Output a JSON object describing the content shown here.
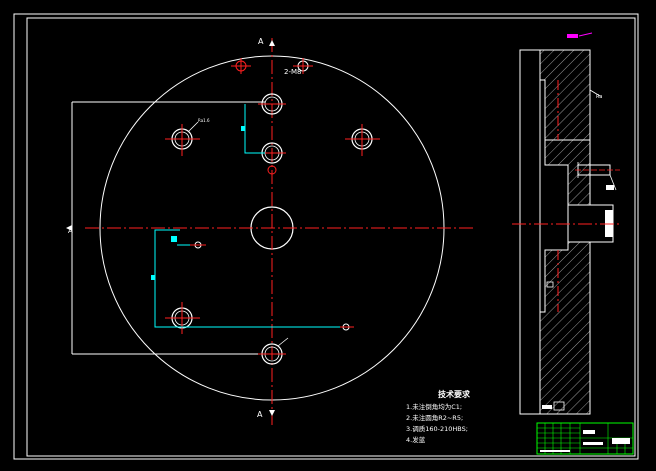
{
  "drawing": {
    "section_marks": {
      "top": "A",
      "bottom": "A",
      "left": "A"
    },
    "hole_label": "2-M8",
    "dimension_note": "Ra1.6",
    "side_view_note": "Ra",
    "notes": {
      "title": "技术要求",
      "items": [
        "1.未注倒角均为C1;",
        "2.未注圆角R2~R5;",
        "3.调质160-210HBS;",
        "4.发蓝"
      ]
    }
  },
  "colors": {
    "background": "#000000",
    "border": "#ffffff",
    "centerline": "#ff2020",
    "dimension": "#00ffff",
    "hatch": "#ffffff",
    "title_block": "#00ff00",
    "tag": "#ff00ff"
  }
}
